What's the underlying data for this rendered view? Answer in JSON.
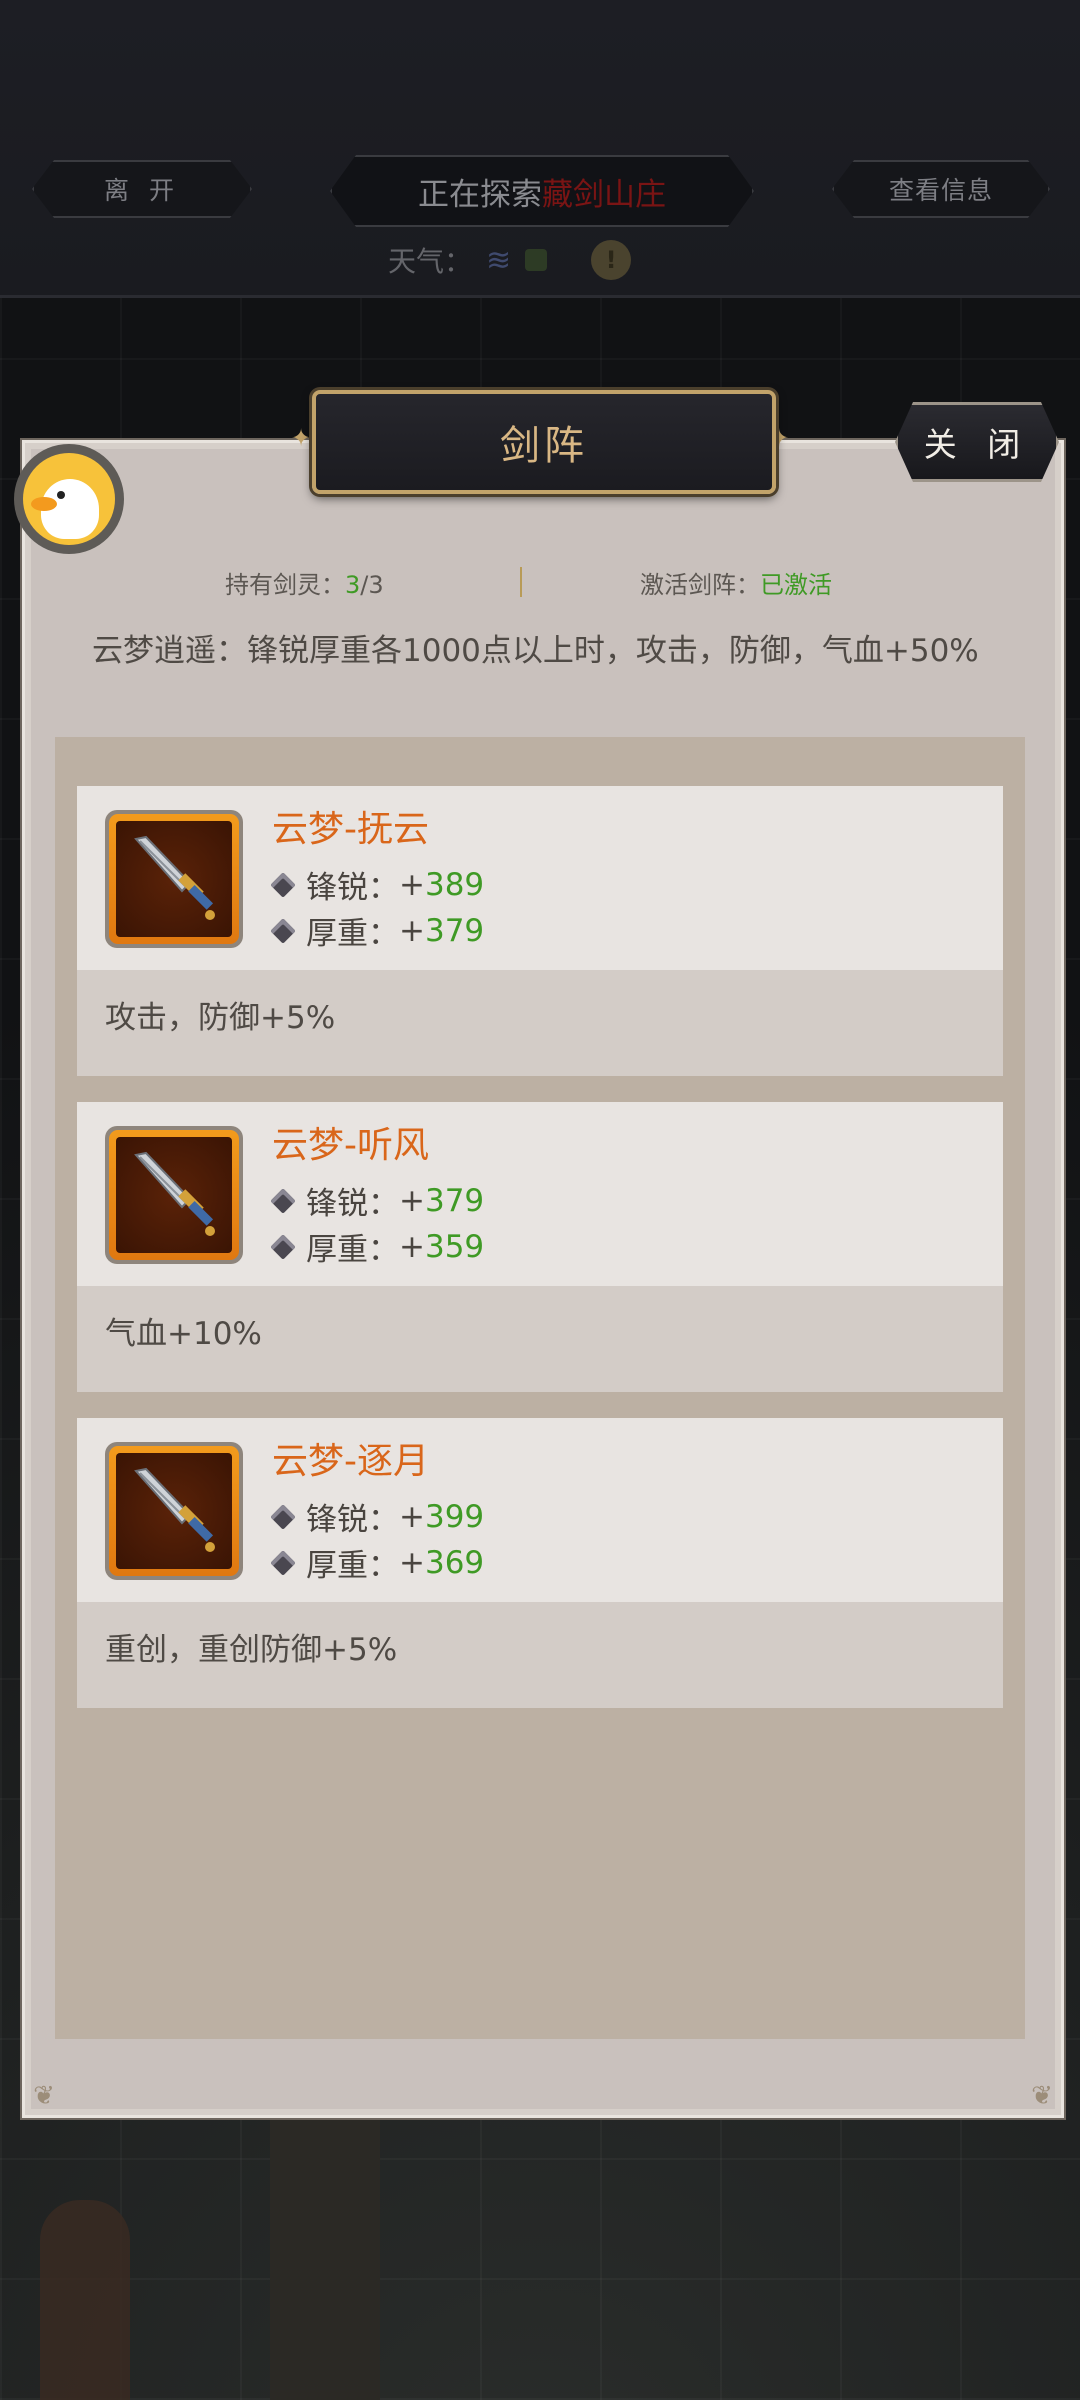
{
  "topbar": {
    "leave_label": "离 开",
    "exploring_prefix": "正在探索",
    "exploring_place": "藏剑山庄",
    "info_label": "查看信息",
    "weather_label": "天气：",
    "weather_icon": "wind-icon",
    "alert_glyph": "!"
  },
  "dialog": {
    "title": "剑阵",
    "close_label": "关 闭",
    "held_label": "持有剑灵：",
    "held_count": "3",
    "held_total": "/3",
    "active_label": "激活剑阵：",
    "active_value": "已激活",
    "effect": "云梦逍遥：锋锐厚重各1000点以上时，攻击，防御，气血+50%"
  },
  "swords": [
    {
      "name": "云梦-抚云",
      "stat1_label": "锋锐：",
      "stat1_sign": "+",
      "stat1_value": "389",
      "stat2_label": "厚重：",
      "stat2_sign": "+",
      "stat2_value": "379",
      "bonus": "攻击，防御+5%"
    },
    {
      "name": "云梦-听风",
      "stat1_label": "锋锐：",
      "stat1_sign": "+",
      "stat1_value": "379",
      "stat2_label": "厚重：",
      "stat2_sign": "+",
      "stat2_value": "359",
      "bonus": "气血+10%"
    },
    {
      "name": "云梦-逐月",
      "stat1_label": "锋锐：",
      "stat1_sign": "+",
      "stat1_value": "399",
      "stat2_label": "厚重：",
      "stat2_sign": "+",
      "stat2_value": "369",
      "bonus": "重创，重创防御+5%"
    }
  ],
  "colors": {
    "name_orange": "#d9661a",
    "value_green": "#3f9a25",
    "title_gold": "#d9b784",
    "place_red": "#7a1414"
  }
}
